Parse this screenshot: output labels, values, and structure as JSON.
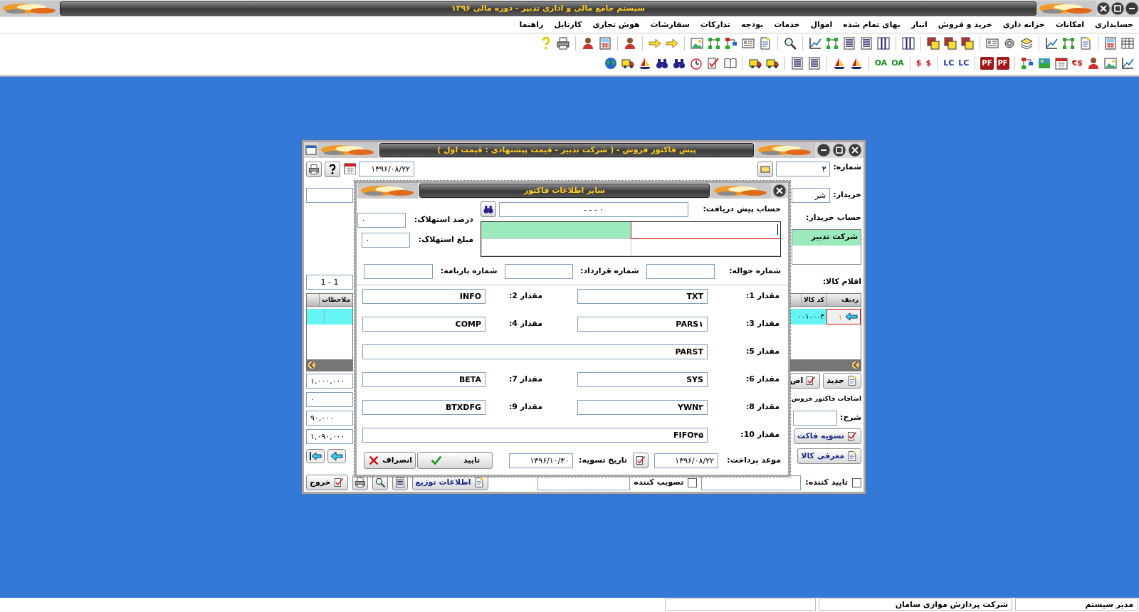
{
  "app": {
    "title": "سیستم جامع مالی و اداری تدبیر - دوره مالی ۱۳۹۶"
  },
  "menu": [
    {
      "label": "حسابداری"
    },
    {
      "label": "امکانات"
    },
    {
      "label": "خزانه داری"
    },
    {
      "label": "خرید و فروش"
    },
    {
      "label": "انبار"
    },
    {
      "label": "بهای تمام شده"
    },
    {
      "label": "اموال"
    },
    {
      "label": "خدمات"
    },
    {
      "label": "بودجه"
    },
    {
      "label": "تدارکات"
    },
    {
      "label": "سفارشات"
    },
    {
      "label": "هوش تجاری"
    },
    {
      "label": "کارتابل"
    },
    {
      "label": "راهنما"
    }
  ],
  "toolbars": [
    [
      {
        "kind": "icon"
      },
      {
        "kind": "icon"
      },
      {
        "kind": "separator"
      },
      {
        "kind": "icon"
      },
      {
        "kind": "icon"
      },
      {
        "kind": "icon"
      },
      {
        "kind": "separator"
      },
      {
        "kind": "icon"
      },
      {
        "kind": "icon"
      },
      {
        "kind": "icon"
      },
      {
        "kind": "separator"
      },
      {
        "kind": "icon"
      },
      {
        "kind": "icon"
      },
      {
        "kind": "icon"
      },
      {
        "kind": "separator"
      },
      {
        "kind": "icon"
      },
      {
        "kind": "separator"
      },
      {
        "kind": "icon"
      },
      {
        "kind": "icon"
      },
      {
        "kind": "icon"
      },
      {
        "kind": "icon"
      },
      {
        "kind": "icon"
      },
      {
        "kind": "separator"
      },
      {
        "kind": "icon"
      },
      {
        "kind": "separator"
      },
      {
        "kind": "icon"
      },
      {
        "kind": "icon"
      },
      {
        "kind": "icon"
      },
      {
        "kind": "icon"
      },
      {
        "kind": "icon"
      },
      {
        "kind": "separator"
      },
      {
        "kind": "icon"
      },
      {
        "kind": "icon"
      },
      {
        "kind": "separator"
      },
      {
        "kind": "icon"
      },
      {
        "kind": "separator"
      },
      {
        "kind": "icon"
      },
      {
        "kind": "icon"
      },
      {
        "kind": "separator"
      },
      {
        "kind": "icon"
      },
      {
        "kind": "icon"
      }
    ],
    [
      {
        "kind": "icon"
      },
      {
        "kind": "icon"
      },
      {
        "kind": "icon"
      },
      {
        "kind": "text",
        "label": "$€",
        "color": "#cc1111"
      },
      {
        "kind": "icon"
      },
      {
        "kind": "icon"
      },
      {
        "kind": "icon"
      },
      {
        "kind": "separator"
      },
      {
        "kind": "badge",
        "label": "PF",
        "color": "#a01818"
      },
      {
        "kind": "badge",
        "label": "PF",
        "color": "#a01818"
      },
      {
        "kind": "separator"
      },
      {
        "kind": "text",
        "label": "LC",
        "color": "#1a3aa0"
      },
      {
        "kind": "text",
        "label": "LC",
        "color": "#1a3aa0"
      },
      {
        "kind": "separator"
      },
      {
        "kind": "text",
        "label": "$",
        "color": "#cc1111"
      },
      {
        "kind": "text",
        "label": "$",
        "color": "#cc1111"
      },
      {
        "kind": "separator"
      },
      {
        "kind": "text",
        "label": "OA",
        "color": "#1a8a1a"
      },
      {
        "kind": "text",
        "label": "OA",
        "color": "#1a8a1a"
      },
      {
        "kind": "separator"
      },
      {
        "kind": "icon"
      },
      {
        "kind": "icon"
      },
      {
        "kind": "separator"
      },
      {
        "kind": "icon"
      },
      {
        "kind": "icon"
      },
      {
        "kind": "separator"
      },
      {
        "kind": "icon"
      },
      {
        "kind": "icon"
      },
      {
        "kind": "separator"
      },
      {
        "kind": "icon"
      },
      {
        "kind": "icon"
      },
      {
        "kind": "icon"
      },
      {
        "kind": "icon"
      },
      {
        "kind": "icon"
      },
      {
        "kind": "icon"
      },
      {
        "kind": "icon"
      },
      {
        "kind": "icon"
      }
    ]
  ],
  "sales_window": {
    "title": "پیش فاکتور فروش - ( شرکت تدبیر - قیمت پیشنهادی : قیمت اول )",
    "number_label": "شماره:",
    "number_value": "۳",
    "date_value": "۱۳۹۶/۰۸/۲۲",
    "buyer_label": "خریدار:",
    "buyer_value": "شر",
    "buyer_account_label": "حساب خریدار:",
    "buyer_account_value": "شرکت تدبیر",
    "items_label": "اقلام کالا:",
    "page_value": "1 - 1",
    "grid": {
      "columns": [
        "ردیف",
        "کد کالا",
        "ملاحظات"
      ],
      "rows": [
        {
          "index": "۱",
          "code": "۰۰۱۰۰۰۳",
          "selected": true
        }
      ]
    },
    "new_button": "جدید",
    "edit_button": "اص",
    "extras_label": "اضافات فاکتور فروش",
    "description_label": "شرح:",
    "settle_button": "تسویه فاکت",
    "introduce_button": "معرفی کالا",
    "totals": [
      "۱,۰۰۰,۰۰۰",
      "۰",
      "۹۰,۰۰۰",
      "۱,۰۹۰,۰۰۰"
    ],
    "approver": {
      "label": "تایید کننده:",
      "checked": false
    },
    "ratifier": {
      "label": "تصویب کننده",
      "checked": false
    },
    "distribution_button": "اطلاعات توزیع",
    "exit_button": "خروج"
  },
  "dialog": {
    "title": "سایر اطلاعات فاکتور",
    "prepayment_label": "حساب پیش دریافت:",
    "prepayment_value": "- - - ۰",
    "depreciation_percent_label": "درصد استهلاک:",
    "depreciation_percent_value": "۰",
    "depreciation_amount_label": "مبلغ استهلاک:",
    "depreciation_amount_value": "۰",
    "grid_rows": [
      {
        "selected": true
      },
      {
        "selected": false
      }
    ],
    "ref_fields": [
      {
        "label": "شماره حواله:"
      },
      {
        "label": "شماره قرارداد:"
      },
      {
        "label": "شماره بارنامه:"
      }
    ],
    "value_rows": [
      [
        {
          "label": "مقدار 1:",
          "value": "TXT"
        },
        {
          "label": "مقدار 2:",
          "value": "INFO"
        }
      ],
      [
        {
          "label": "مقدار 3:",
          "value": "PARS۱"
        },
        {
          "label": "مقدار 4:",
          "value": "COMP"
        }
      ],
      [
        {
          "label": "مقدار 5:",
          "value": "PARST"
        }
      ],
      [
        {
          "label": "مقدار 6:",
          "value": "SYS"
        },
        {
          "label": "مقدار 7:",
          "value": "BETA"
        }
      ],
      [
        {
          "label": "مقدار 8:",
          "value": "YWN۳"
        },
        {
          "label": "مقدار 9:",
          "value": "BTXDFG"
        }
      ],
      [
        {
          "label": "مقدار 10:",
          "value": "FIFO۴۵"
        }
      ]
    ],
    "payment_due_label": "موعد پرداخت:",
    "payment_due_value": "۱۳۹۶/۰۸/۲۲",
    "settlement_label": "تاریخ تسویه:",
    "settlement_value": "۱۳۹۶/۱۰/۳۰",
    "buttons": [
      {
        "label": "تایید",
        "kind": "ok"
      },
      {
        "label": "انصراف",
        "kind": "cancel"
      }
    ]
  },
  "status_bar": [
    "مدیر سیستم",
    "شرکت پردازش موازی سامان"
  ]
}
